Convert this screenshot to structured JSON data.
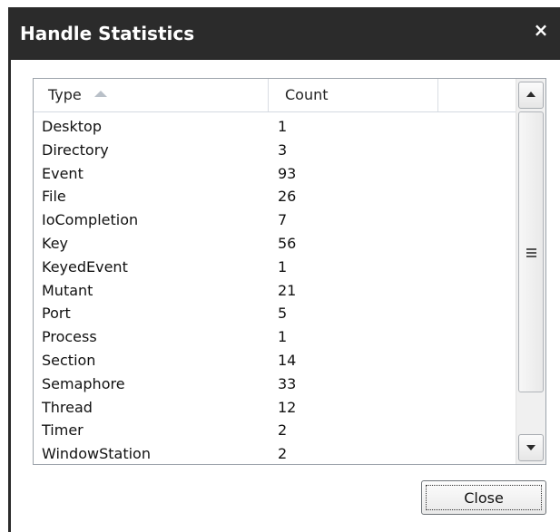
{
  "window": {
    "title": "Handle Statistics",
    "close_glyph": "×"
  },
  "table": {
    "columns": [
      {
        "label": "Type",
        "sorted": "ascending"
      },
      {
        "label": "Count"
      }
    ],
    "rows": [
      {
        "type": "Desktop",
        "count": "1"
      },
      {
        "type": "Directory",
        "count": "3"
      },
      {
        "type": "Event",
        "count": "93"
      },
      {
        "type": "File",
        "count": "26"
      },
      {
        "type": "IoCompletion",
        "count": "7"
      },
      {
        "type": "Key",
        "count": "56"
      },
      {
        "type": "KeyedEvent",
        "count": "1"
      },
      {
        "type": "Mutant",
        "count": "21"
      },
      {
        "type": "Port",
        "count": "5"
      },
      {
        "type": "Process",
        "count": "1"
      },
      {
        "type": "Section",
        "count": "14"
      },
      {
        "type": "Semaphore",
        "count": "33"
      },
      {
        "type": "Thread",
        "count": "12"
      },
      {
        "type": "Timer",
        "count": "2"
      },
      {
        "type": "WindowStation",
        "count": "2"
      }
    ]
  },
  "buttons": {
    "close_label": "Close"
  },
  "icons": {
    "close": "close-icon",
    "sort": "sort-ascending-icon",
    "scroll_up": "scroll-up-arrow-icon",
    "scroll_down": "scroll-down-arrow-icon",
    "thumb_grip": "grip-icon"
  }
}
